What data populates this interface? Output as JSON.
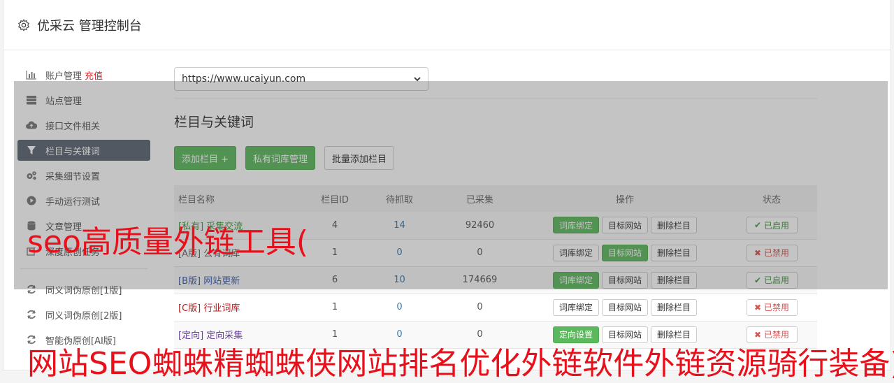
{
  "header": {
    "title": "优采云 管理控制台",
    "icon": "gear-icon"
  },
  "sidebar": {
    "items": [
      {
        "label": "账户管理",
        "extra": "充值",
        "icon": "bar-chart-icon"
      },
      {
        "label": "站点管理",
        "icon": "server-icon"
      },
      {
        "label": "接口文件相关",
        "icon": "cloud-upload-icon"
      },
      {
        "label": "栏目与关键词",
        "icon": "filter-icon",
        "active": true
      },
      {
        "label": "采集细节设置",
        "icon": "cogs-icon"
      },
      {
        "label": "手动运行测试",
        "icon": "play-circle-icon"
      },
      {
        "label": "文章管理",
        "icon": "database-icon"
      },
      {
        "label": "深度原创任务",
        "icon": "edit-icon"
      }
    ],
    "items2": [
      {
        "label": "同义词伪原创[1版]",
        "icon": "refresh-icon"
      },
      {
        "label": "同义词伪原创[2版]",
        "icon": "refresh-icon"
      },
      {
        "label": "智能伪原创[AI版]",
        "icon": "refresh-icon"
      }
    ]
  },
  "main": {
    "site_select": "https://www.ucaiyun.com",
    "section_title": "栏目与关键词",
    "buttons": {
      "add": "添加栏目 +",
      "lexicon": "私有词库管理",
      "batch": "批量添加栏目"
    },
    "table": {
      "headers": [
        "栏目名称",
        "栏目ID",
        "待抓取",
        "已采集",
        "操作",
        "状态"
      ],
      "rows": [
        {
          "tag": "[私有]",
          "name": "采集交流",
          "id": "4",
          "pending": "14",
          "collected": "92460",
          "op1": "词库绑定",
          "op1_green": true,
          "op2": "目标网站",
          "op2_green": false,
          "op3": "删除栏目",
          "status": "已启用",
          "on": true
        },
        {
          "tag": "[A版]",
          "name": "公有词库",
          "id": "1",
          "pending": "0",
          "collected": "0",
          "op1": "词库绑定",
          "op1_green": false,
          "op2": "目标网站",
          "op2_green": true,
          "op3": "删除栏目",
          "status": "已禁用",
          "on": false
        },
        {
          "tag": "[B版]",
          "name": "网站更新",
          "id": "6",
          "pending": "10",
          "collected": "174669",
          "op1": "词库绑定",
          "op1_green": true,
          "op2": "目标网站",
          "op2_green": false,
          "op3": "删除栏目",
          "status": "已启用",
          "on": true
        },
        {
          "tag": "[C版]",
          "name": "行业词库",
          "id": "1",
          "pending": "0",
          "collected": "0",
          "op1": "词库绑定",
          "op1_green": false,
          "op2": "目标网站",
          "op2_green": false,
          "op3": "删除栏目",
          "status": "已禁用",
          "on": false
        },
        {
          "tag": "[定向]",
          "name": "定向采集",
          "id": "1",
          "pending": "0",
          "collected": "0",
          "op1": "定向设置",
          "op1_green": true,
          "op2": "目标网站",
          "op2_green": false,
          "op3": "删除栏目",
          "status": "已禁用",
          "on": false
        }
      ]
    }
  },
  "watermarks": {
    "line1": "seo高质量外链工具(",
    "line2": "网站SEO蜘蛛精蜘蛛侠网站排名优化外链软件外链资源骑行装备)"
  },
  "colors": {
    "accent_green": "#5cb85c",
    "active_nav": "#5b6572",
    "recharge_red": "#e2222b",
    "watermark_red": "#e8101a"
  }
}
